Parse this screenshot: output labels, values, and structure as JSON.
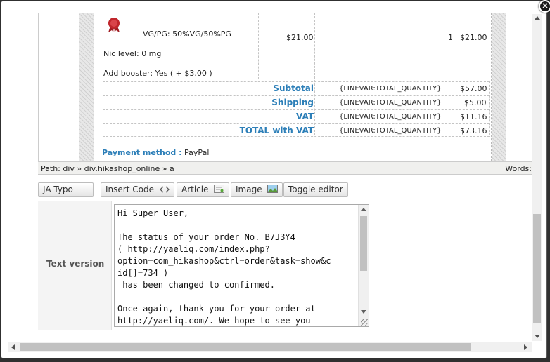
{
  "dialog": {
    "close_glyph": "×"
  },
  "order_row": {
    "vg_pg": "VG/PG: 50%VG/50%PG",
    "price": "$21.00",
    "quantity": "1",
    "line_total": "$21.00",
    "nic_level": "Nic level: 0 mg",
    "booster": "Add booster: Yes ( + $3.00 )"
  },
  "totals": [
    {
      "label": "Subtotal",
      "qty": "{LINEVAR:TOTAL_QUANTITY}",
      "amount": "$57.00"
    },
    {
      "label": "Shipping",
      "qty": "{LINEVAR:TOTAL_QUANTITY}",
      "amount": "$5.00"
    },
    {
      "label": "VAT",
      "qty": "{LINEVAR:TOTAL_QUANTITY}",
      "amount": "$11.16"
    },
    {
      "label": "TOTAL with VAT",
      "qty": "{LINEVAR:TOTAL_QUANTITY}",
      "amount": "$73.16"
    }
  ],
  "payment": {
    "label": "Payment method :",
    "value": "PayPal"
  },
  "pathbar": {
    "path": "Path: div » div.hikashop_online » a",
    "words": "Words:"
  },
  "toolbar": {
    "ja_typo": "JA Typo",
    "insert_code": "Insert Code",
    "article": "Article",
    "image": "Image",
    "toggle_editor": "Toggle editor"
  },
  "text_version": {
    "label": "Text version",
    "content": "Hi Super User,\n\nThe status of your order No. B7J3Y4\n( http://yaeliq.com/index.php?\noption=com_hikashop&ctrl=order&task=show&c\nid[]=734 )\n has been changed to confirmed.\n\nOnce again, thank you for your order at\nhttp://yaeliq.com/. We hope to see you"
  },
  "colors": {
    "accent_blue": "#2d7fb8",
    "medal_red": "#c0262c"
  }
}
